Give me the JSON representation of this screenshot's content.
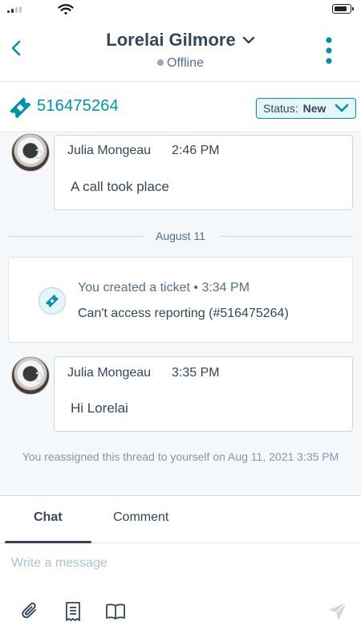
{
  "header": {
    "contact_name": "Lorelai Gilmore",
    "presence": "Offline"
  },
  "ticket": {
    "number": "516475264",
    "status_label": "Status:",
    "status_value": "New"
  },
  "thread": {
    "messages": [
      {
        "sender": "Julia Mongeau",
        "time": "2:46 PM",
        "body": "A call took place"
      },
      {
        "sender": "Julia Mongeau",
        "time": "3:35 PM",
        "body": "Hi Lorelai"
      }
    ],
    "date_divider": "August 11",
    "event": {
      "line1": "You created a ticket • 3:34 PM",
      "line2": "Can't access reporting (#516475264)"
    },
    "reassign_note": "You reassigned this thread to yourself on Aug 11, 2021 3:35 PM"
  },
  "tabs": [
    {
      "label": "Chat",
      "active": true
    },
    {
      "label": "Comment",
      "active": false
    }
  ],
  "composer": {
    "placeholder": "Write a message"
  },
  "colors": {
    "accent": "#0091ae",
    "text": "#33475b",
    "muted": "#7c98b6",
    "thread_bg": "#f5f8fa"
  },
  "icons": [
    "signal-icon",
    "wifi-icon",
    "battery-icon",
    "back-chevron-icon",
    "chevron-down-icon",
    "more-vertical-icon",
    "ticket-icon",
    "attachment-icon",
    "snippet-icon",
    "knowledge-base-icon",
    "send-icon"
  ]
}
